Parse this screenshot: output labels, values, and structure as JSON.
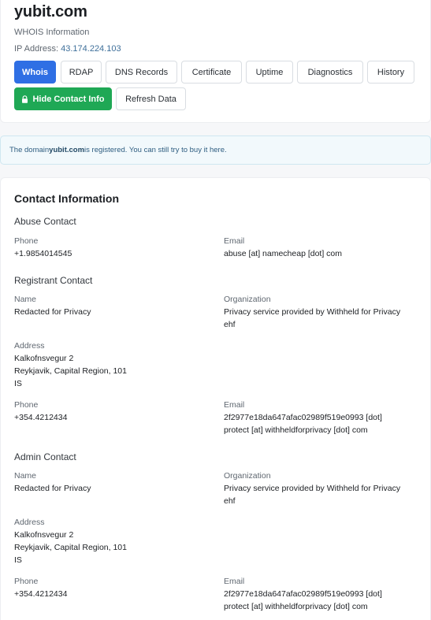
{
  "header": {
    "domain": "yubit.com",
    "subtitle": "WHOIS Information",
    "ip_label": "IP Address:",
    "ip_value": "43.174.224.103"
  },
  "tabs": [
    {
      "label": "Whois",
      "active": true
    },
    {
      "label": "RDAP",
      "active": false
    },
    {
      "label": "DNS Records",
      "active": false
    },
    {
      "label": "Certificate",
      "active": false
    },
    {
      "label": "Uptime",
      "active": false
    },
    {
      "label": "Diagnostics",
      "active": false
    },
    {
      "label": "History",
      "active": false
    }
  ],
  "actions": {
    "hide_contact": "Hide Contact Info",
    "refresh": "Refresh Data"
  },
  "notice": {
    "prefix": "The domain ",
    "domain": "yubit.com",
    "suffix": " is registered. You can still try to buy it here."
  },
  "contact": {
    "title": "Contact Information",
    "abuse": {
      "heading": "Abuse Contact",
      "phone_label": "Phone",
      "phone": "+1.9854014545",
      "email_label": "Email",
      "email": "abuse [at] namecheap [dot] com"
    },
    "registrant": {
      "heading": "Registrant Contact",
      "name_label": "Name",
      "name": "Redacted for Privacy",
      "org_label": "Organization",
      "org_line1": "Privacy service provided by Withheld for Privacy",
      "org_line2": "ehf",
      "address_label": "Address",
      "address_line1": "Kalkofnsvegur 2",
      "address_line2": "Reykjavik, Capital Region, 101",
      "address_line3": "IS",
      "phone_label": "Phone",
      "phone": "+354.4212434",
      "email_label": "Email",
      "email_line1": "2f2977e18da647afac02989f519e0993 [dot]",
      "email_line2": "protect [at] withheldforprivacy [dot] com"
    },
    "admin": {
      "heading": "Admin Contact",
      "name_label": "Name",
      "name": "Redacted for Privacy",
      "org_label": "Organization",
      "org_line1": "Privacy service provided by Withheld for Privacy",
      "org_line2": "ehf",
      "address_label": "Address",
      "address_line1": "Kalkofnsvegur 2",
      "address_line2": "Reykjavik, Capital Region, 101",
      "address_line3": "IS",
      "phone_label": "Phone",
      "phone": "+354.4212434",
      "email_label": "Email",
      "email_line1": "2f2977e18da647afac02989f519e0993 [dot]",
      "email_line2": "protect [at] withheldforprivacy [dot] com"
    }
  },
  "colors": {
    "primary": "#2f6fe4",
    "success": "#1fa855",
    "link": "#3e6f9a"
  },
  "icons": {
    "hide_contact": "lock-icon"
  }
}
